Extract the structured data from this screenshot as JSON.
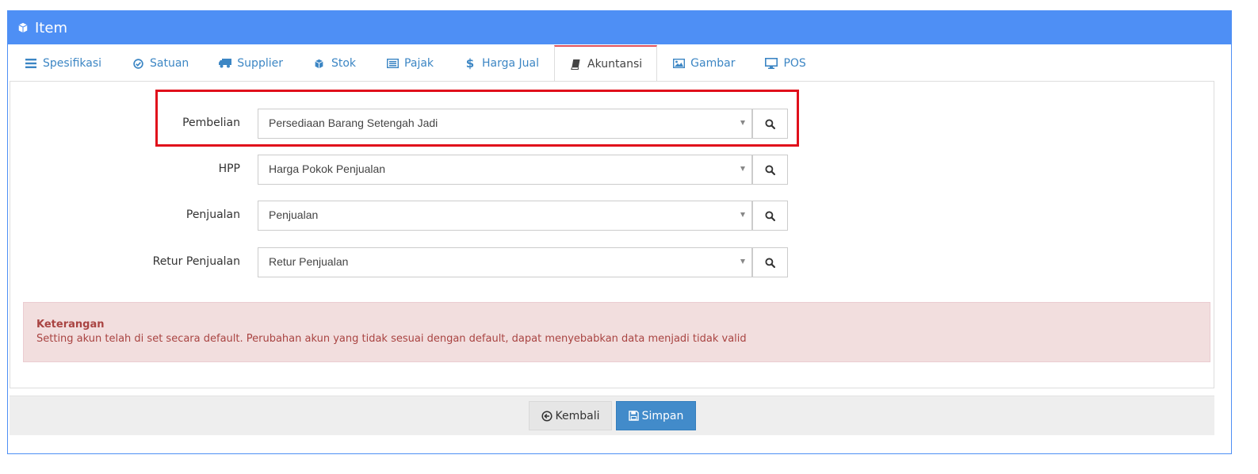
{
  "header": {
    "title": "Item",
    "icon": "cube-icon"
  },
  "tabs": [
    {
      "label": "Spesifikasi",
      "icon": "list-icon"
    },
    {
      "label": "Satuan",
      "icon": "check-circle-icon"
    },
    {
      "label": "Supplier",
      "icon": "truck-icon"
    },
    {
      "label": "Stok",
      "icon": "cube-icon"
    },
    {
      "label": "Pajak",
      "icon": "list-alt-icon"
    },
    {
      "label": "Harga Jual",
      "icon": "dollar-icon"
    },
    {
      "label": "Akuntansi",
      "icon": "book-icon",
      "active": true
    },
    {
      "label": "Gambar",
      "icon": "picture-icon"
    },
    {
      "label": "POS",
      "icon": "desktop-icon"
    }
  ],
  "form": {
    "pembelian": {
      "label": "Pembelian",
      "value": "Persediaan Barang Setengah Jadi"
    },
    "hpp": {
      "label": "HPP",
      "value": "Harga Pokok Penjualan"
    },
    "penjualan": {
      "label": "Penjualan",
      "value": "Penjualan"
    },
    "retur_penjualan": {
      "label": "Retur Penjualan",
      "value": "Retur Penjualan"
    }
  },
  "alert": {
    "title": "Keterangan",
    "message": "Setting akun telah di set secara default. Perubahan akun yang tidak sesuai dengan default, dapat menyebabkan data menjadi tidak valid"
  },
  "footer": {
    "back_label": "Kembali",
    "save_label": "Simpan"
  },
  "colors": {
    "header": "#4e8ff5",
    "active_tab_border": "#e0525d",
    "highlight": "#e0101b",
    "save_button": "#428bca",
    "alert_bg": "#f2dede"
  }
}
